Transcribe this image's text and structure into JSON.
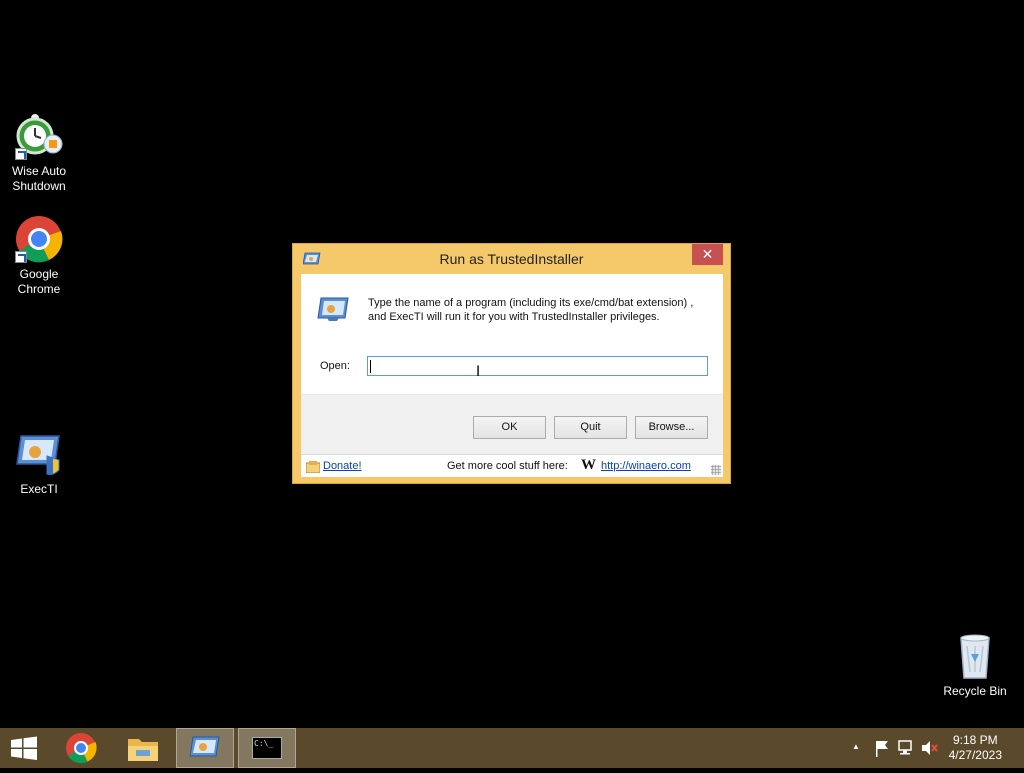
{
  "desktop": {
    "icons": [
      {
        "label_line1": "Wise Auto",
        "label_line2": "Shutdown",
        "icon": "wise-auto-shutdown-icon"
      },
      {
        "label_line1": "Google",
        "label_line2": "Chrome",
        "icon": "chrome-icon"
      },
      {
        "label_line1": "ExecTI",
        "label_line2": "",
        "icon": "execti-icon"
      },
      {
        "label_line1": "Recycle Bin",
        "label_line2": "",
        "icon": "recycle-bin-icon"
      }
    ]
  },
  "dialog": {
    "title": "Run as TrustedInstaller",
    "close_symbol": "✕",
    "prompt_line1": "Type the name of a program (including its exe/cmd/bat extension) ,",
    "prompt_line2": "and ExecTI will run it for you with TrustedInstaller privileges.",
    "open_label": "Open:",
    "open_value": "",
    "buttons": {
      "ok": "OK",
      "quit": "Quit",
      "browse": "Browse..."
    },
    "status": {
      "donate": "Donate!",
      "more_text": "Get more cool stuff here:",
      "w_logo": "W",
      "link": "http://winaero.com"
    }
  },
  "taskbar": {
    "items": [
      "start-button",
      "chrome",
      "file-explorer",
      "execti",
      "command-prompt"
    ],
    "cmd_text": "C:\\_",
    "clock": {
      "time": "9:18 PM",
      "date": "4/27/2023"
    },
    "tray_up_arrow": "▲"
  },
  "colors": {
    "dialog_frame": "#f5c96a",
    "close_button": "#c75050",
    "taskbar": "#5a4a2b",
    "link": "#0645ad"
  }
}
